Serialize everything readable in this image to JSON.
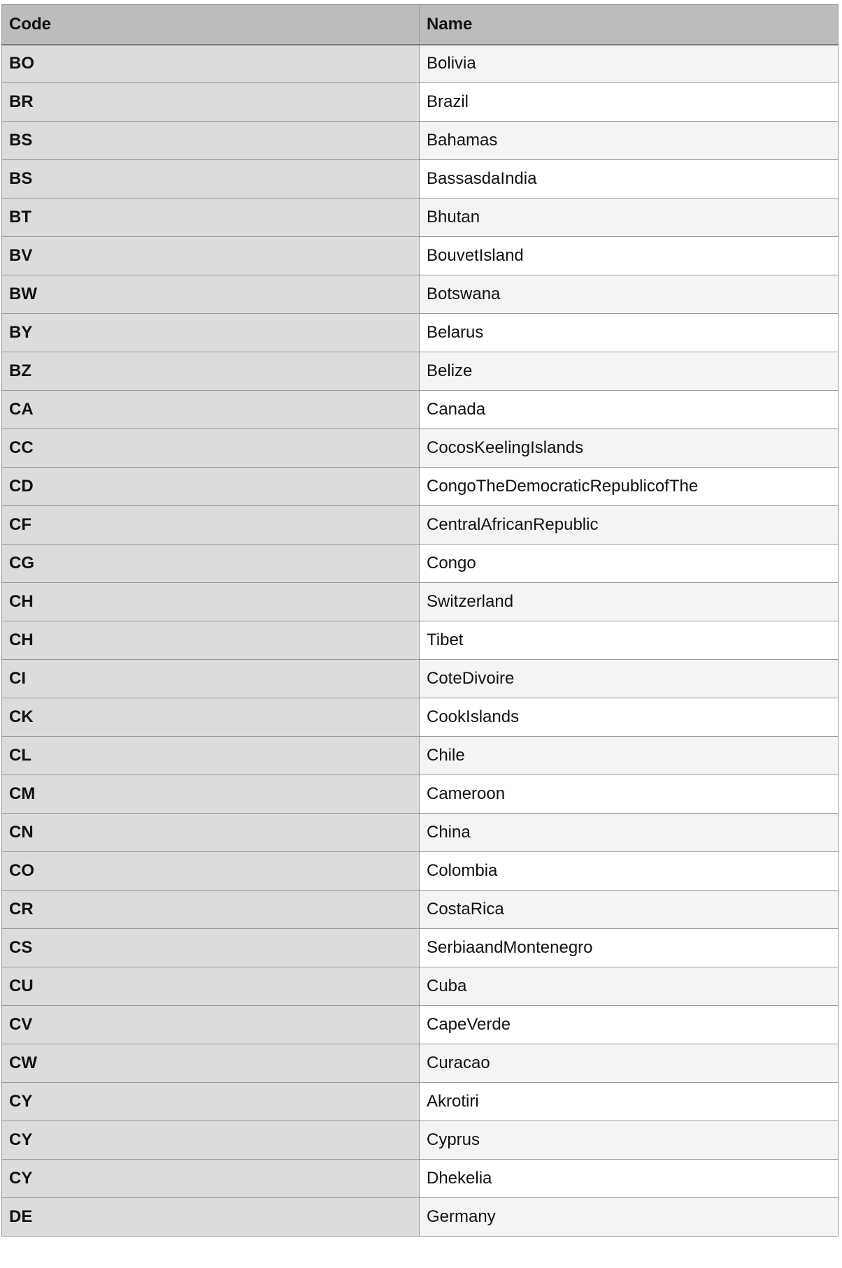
{
  "table": {
    "headers": {
      "code": "Code",
      "name": "Name"
    },
    "rows": [
      {
        "code": "BO",
        "name": "Bolivia"
      },
      {
        "code": "BR",
        "name": "Brazil"
      },
      {
        "code": "BS",
        "name": "Bahamas"
      },
      {
        "code": "BS",
        "name": "BassasdaIndia"
      },
      {
        "code": "BT",
        "name": "Bhutan"
      },
      {
        "code": "BV",
        "name": "BouvetIsland"
      },
      {
        "code": "BW",
        "name": "Botswana"
      },
      {
        "code": "BY",
        "name": "Belarus"
      },
      {
        "code": "BZ",
        "name": "Belize"
      },
      {
        "code": "CA",
        "name": "Canada"
      },
      {
        "code": "CC",
        "name": "CocosKeelingIslands"
      },
      {
        "code": "CD",
        "name": "CongoTheDemocraticRepublicofThe"
      },
      {
        "code": "CF",
        "name": "CentralAfricanRepublic"
      },
      {
        "code": "CG",
        "name": "Congo"
      },
      {
        "code": "CH",
        "name": "Switzerland"
      },
      {
        "code": "CH",
        "name": "Tibet"
      },
      {
        "code": "CI",
        "name": "CoteDivoire"
      },
      {
        "code": "CK",
        "name": "CookIslands"
      },
      {
        "code": "CL",
        "name": "Chile"
      },
      {
        "code": "CM",
        "name": "Cameroon"
      },
      {
        "code": "CN",
        "name": "China"
      },
      {
        "code": "CO",
        "name": "Colombia"
      },
      {
        "code": "CR",
        "name": "CostaRica"
      },
      {
        "code": "CS",
        "name": "SerbiaandMontenegro"
      },
      {
        "code": "CU",
        "name": "Cuba"
      },
      {
        "code": "CV",
        "name": "CapeVerde"
      },
      {
        "code": "CW",
        "name": "Curacao"
      },
      {
        "code": "CY",
        "name": "Akrotiri"
      },
      {
        "code": "CY",
        "name": "Cyprus"
      },
      {
        "code": "CY",
        "name": "Dhekelia"
      },
      {
        "code": "DE",
        "name": "Germany"
      }
    ]
  },
  "colors": {
    "header_bg": "#bcbcbc",
    "code_col_bg": "#dcdcdc",
    "row_alt_bg": "#f4f4f4",
    "row_bg": "#ffffff",
    "border": "#9a9a9a"
  }
}
